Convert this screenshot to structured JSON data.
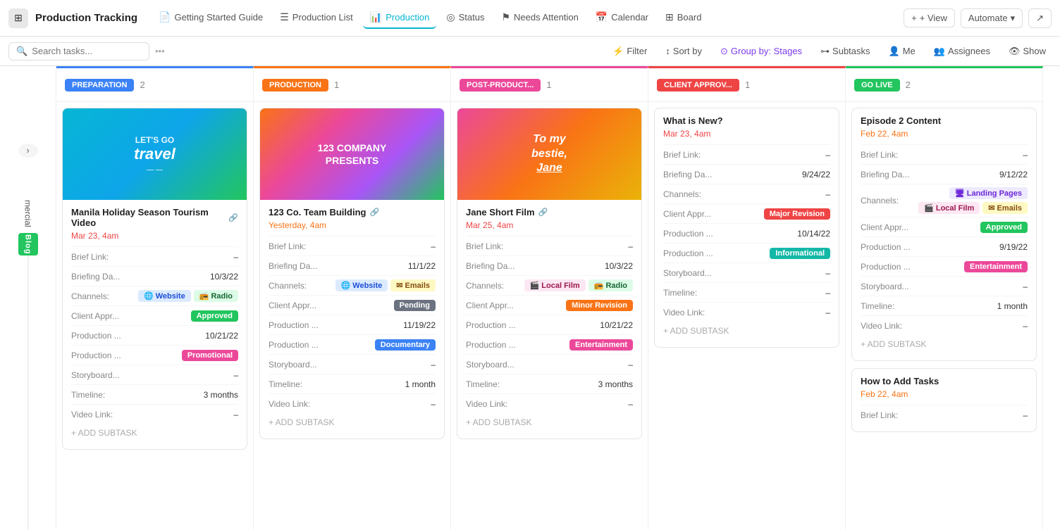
{
  "app": {
    "title": "Production Tracking",
    "logo_icon": "≡"
  },
  "nav": {
    "tabs": [
      {
        "id": "getting-started",
        "label": "Getting Started Guide",
        "icon": "📄",
        "active": false
      },
      {
        "id": "production-list",
        "label": "Production List",
        "icon": "☰",
        "active": false
      },
      {
        "id": "production",
        "label": "Production",
        "icon": "📊",
        "active": true
      },
      {
        "id": "status",
        "label": "Status",
        "icon": "◎",
        "active": false
      },
      {
        "id": "needs-attention",
        "label": "Needs Attention",
        "icon": "⚑",
        "active": false
      },
      {
        "id": "calendar",
        "label": "Calendar",
        "icon": "📅",
        "active": false
      },
      {
        "id": "board",
        "label": "Board",
        "icon": "⊞",
        "active": false
      }
    ],
    "view_btn": "+ View",
    "automate_btn": "Automate"
  },
  "toolbar": {
    "search_placeholder": "Search tasks...",
    "filter_label": "Filter",
    "sort_label": "Sort by",
    "group_label": "Group by: Stages",
    "subtasks_label": "Subtasks",
    "me_label": "Me",
    "assignees_label": "Assignees",
    "show_label": "Show"
  },
  "columns": [
    {
      "id": "narrow",
      "type": "narrow"
    },
    {
      "id": "preparation",
      "label": "PREPARATION",
      "badge_color": "#3b82f6",
      "count": "2",
      "border_color": "#3b82f6",
      "cards": [
        {
          "id": "manila",
          "title": "Manila Holiday Season Tourism Video",
          "has_link_icon": true,
          "date": "Mar 23, 4am",
          "date_color": "#ef4444",
          "img_type": "travel",
          "img_label": "Let's Go Travel",
          "fields": [
            {
              "label": "Brief Link:",
              "value": "–"
            },
            {
              "label": "Briefing Da...",
              "value": "10/3/22"
            },
            {
              "label": "Channels:",
              "tags": [
                {
                  "text": "🌐 Website",
                  "cls": "tag-website"
                },
                {
                  "text": "📻 Radio",
                  "cls": "tag-radio"
                }
              ]
            },
            {
              "label": "Client Appr...",
              "tags": [
                {
                  "text": "Approved",
                  "cls": "tag-green"
                }
              ]
            },
            {
              "label": "Production ...",
              "value": "10/21/22"
            },
            {
              "label": "Production ...",
              "tags": [
                {
                  "text": "Promotional",
                  "cls": "tag-pink"
                }
              ]
            },
            {
              "label": "Storyboard...",
              "value": "–"
            },
            {
              "label": "Timeline:",
              "value": "3 months"
            },
            {
              "label": "Video Link:",
              "value": "–"
            }
          ],
          "add_subtask": "+ ADD SUBTASK"
        }
      ]
    },
    {
      "id": "production",
      "label": "PRODUCTION",
      "badge_color": "#f97316",
      "count": "1",
      "border_color": "#f97316",
      "cards": [
        {
          "id": "123co",
          "title": "123 Co. Team Building",
          "has_link_icon": true,
          "date": "Yesterday, 4am",
          "date_color": "#f97316",
          "img_type": "123co",
          "img_label": "123 COMPANY PRESENTS",
          "fields": [
            {
              "label": "Brief Link:",
              "value": "–"
            },
            {
              "label": "Briefing Da...",
              "value": "11/1/22"
            },
            {
              "label": "Channels:",
              "tags": [
                {
                  "text": "🌐 Website",
                  "cls": "tag-website"
                },
                {
                  "text": "✉ Emails",
                  "cls": "tag-email"
                }
              ]
            },
            {
              "label": "Client Appr...",
              "tags": [
                {
                  "text": "Pending",
                  "cls": "tag-gray"
                }
              ]
            },
            {
              "label": "Production ...",
              "value": "11/19/22"
            },
            {
              "label": "Production ...",
              "tags": [
                {
                  "text": "Documentary",
                  "cls": "tag-blue"
                }
              ]
            },
            {
              "label": "Storyboard...",
              "value": "–"
            },
            {
              "label": "Timeline:",
              "value": "1 month"
            },
            {
              "label": "Video Link:",
              "value": "–"
            }
          ],
          "add_subtask": "+ ADD SUBTASK"
        }
      ]
    },
    {
      "id": "post-production",
      "label": "POST-PRODUCT...",
      "badge_color": "#ec4899",
      "count": "1",
      "border_color": "#ec4899",
      "cards": [
        {
          "id": "jane",
          "title": "Jane Short Film",
          "has_link_icon": true,
          "date": "Mar 25, 4am",
          "date_color": "#ef4444",
          "img_type": "jane",
          "img_label": "To my bestie, Jane",
          "fields": [
            {
              "label": "Brief Link:",
              "value": "–"
            },
            {
              "label": "Briefing Da...",
              "value": "10/3/22"
            },
            {
              "label": "Channels:",
              "tags": [
                {
                  "text": "🎬 Local Film",
                  "cls": "tag-localfilm"
                },
                {
                  "text": "📻 Radio",
                  "cls": "tag-radio"
                }
              ]
            },
            {
              "label": "Client Appr...",
              "tags": [
                {
                  "text": "Minor Revision",
                  "cls": "tag-orange"
                }
              ]
            },
            {
              "label": "Production ...",
              "value": "10/21/22"
            },
            {
              "label": "Production ...",
              "tags": [
                {
                  "text": "Entertainment",
                  "cls": "tag-pink"
                }
              ]
            },
            {
              "label": "Storyboard...",
              "value": "–"
            },
            {
              "label": "Timeline:",
              "value": "3 months"
            },
            {
              "label": "Video Link:",
              "value": "–"
            }
          ],
          "add_subtask": "+ ADD SUBTASK"
        }
      ]
    },
    {
      "id": "client-approval",
      "label": "CLIENT APPROV...",
      "badge_color": "#ef4444",
      "count": "1",
      "border_color": "#ef4444",
      "cards": [
        {
          "id": "what-is-new",
          "title": "What is New?",
          "has_link_icon": false,
          "date": "Mar 23, 4am",
          "date_color": "#ef4444",
          "img_type": "none",
          "fields": [
            {
              "label": "Brief Link:",
              "value": "–"
            },
            {
              "label": "Briefing Da...",
              "value": "9/24/22"
            },
            {
              "label": "Channels:",
              "value": "–"
            },
            {
              "label": "Client Appr...",
              "tags": [
                {
                  "text": "Major Revision",
                  "cls": "tag-red"
                }
              ]
            },
            {
              "label": "Production ...",
              "value": "10/14/22"
            },
            {
              "label": "Production ...",
              "tags": [
                {
                  "text": "Informational",
                  "cls": "tag-teal"
                }
              ]
            },
            {
              "label": "Storyboard...",
              "value": "–"
            },
            {
              "label": "Timeline:",
              "value": "–"
            },
            {
              "label": "Video Link:",
              "value": "–"
            }
          ],
          "add_subtask": "+ ADD SUBTASK"
        }
      ]
    },
    {
      "id": "go-live",
      "label": "GO LIVE",
      "badge_color": "#22c55e",
      "count": "2",
      "border_color": "#22c55e",
      "cards": [
        {
          "id": "episode2",
          "title": "Episode 2 Content",
          "has_link_icon": false,
          "date": "Feb 22, 4am",
          "date_color": "#f97316",
          "img_type": "none",
          "fields": [
            {
              "label": "Brief Link:",
              "value": "–"
            },
            {
              "label": "Briefing Da...",
              "value": "9/12/22"
            },
            {
              "label": "Channels:",
              "tags": [
                {
                  "text": "🖥 Landing Pages",
                  "cls": "tag-landingpage"
                },
                {
                  "text": "🎬 Local Film",
                  "cls": "tag-localfilm"
                },
                {
                  "text": "✉ Emails",
                  "cls": "tag-email"
                }
              ]
            },
            {
              "label": "Client Appr...",
              "tags": [
                {
                  "text": "Approved",
                  "cls": "tag-green"
                }
              ]
            },
            {
              "label": "Production ...",
              "value": "9/19/22"
            },
            {
              "label": "Production ...",
              "tags": [
                {
                  "text": "Entertainment",
                  "cls": "tag-pink"
                }
              ]
            },
            {
              "label": "Storyboard...",
              "value": "–"
            },
            {
              "label": "Timeline:",
              "value": "1 month"
            },
            {
              "label": "Video Link:",
              "value": "–"
            }
          ],
          "add_subtask": "+ ADD SUBTASK"
        },
        {
          "id": "how-to-add",
          "title": "How to Add Tasks",
          "has_link_icon": false,
          "date": "Feb 22, 4am",
          "date_color": "#f97316",
          "img_type": "none",
          "fields": [
            {
              "label": "Brief Link:",
              "value": "–"
            }
          ],
          "add_subtask": ""
        }
      ]
    }
  ],
  "partial_left": {
    "label": "mercial",
    "badge_label": "Blog",
    "badge_color": "#22c55e"
  }
}
